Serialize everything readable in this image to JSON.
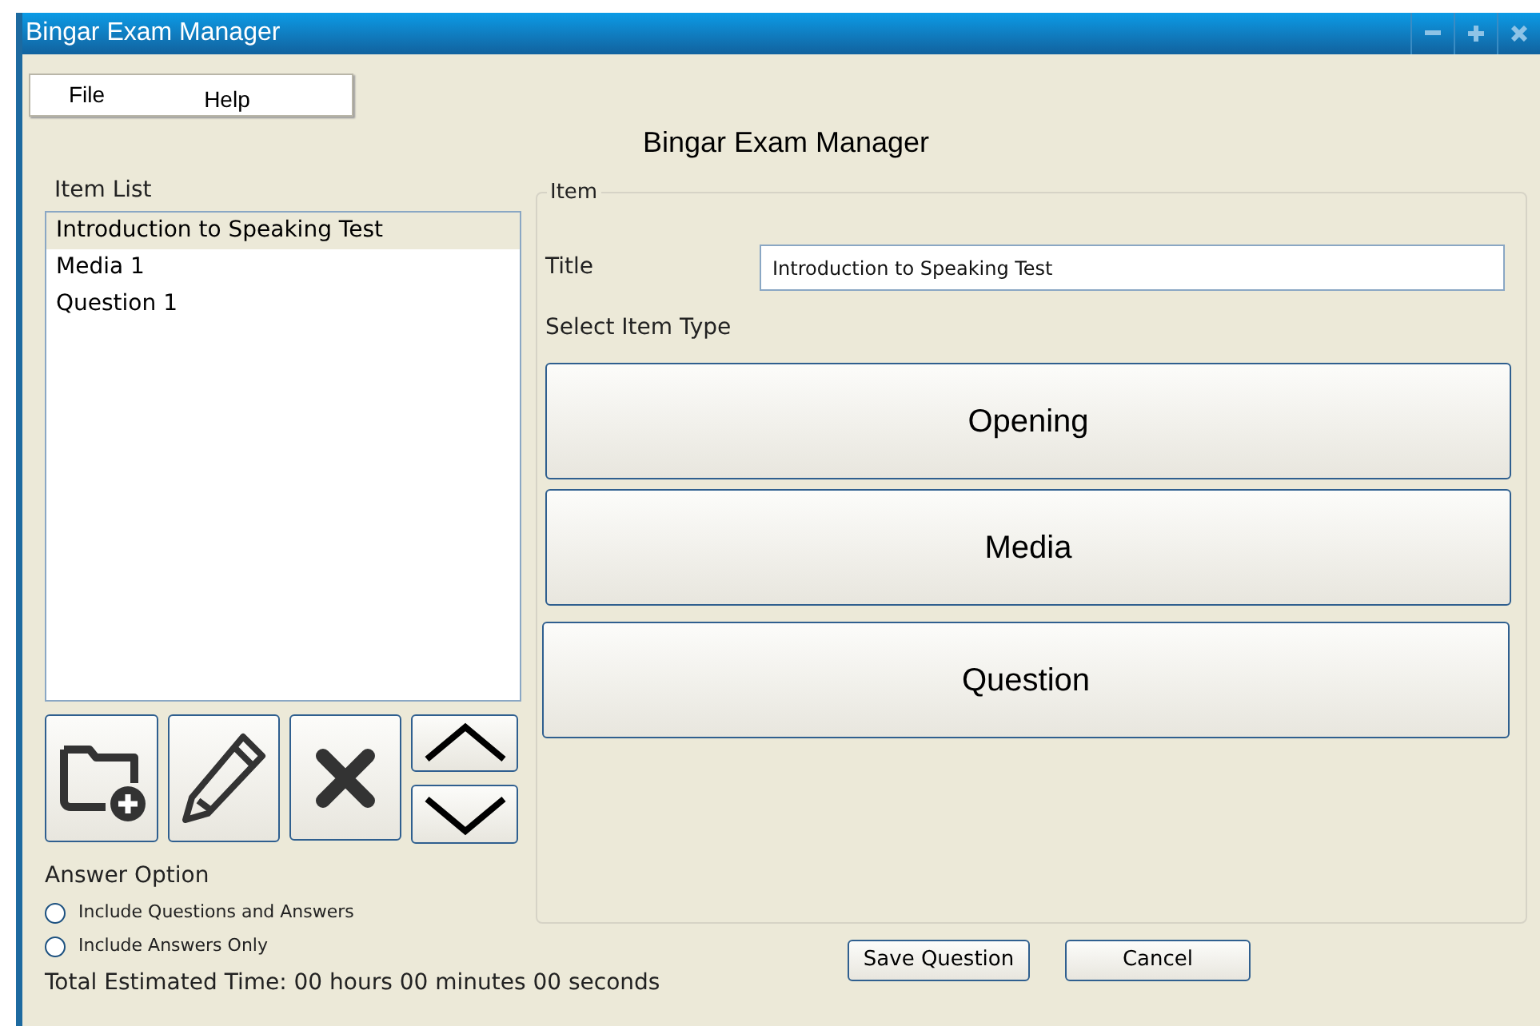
{
  "window": {
    "title": "Bingar Exam Manager"
  },
  "menu": [
    {
      "label": "File"
    },
    {
      "label": "Help"
    }
  ],
  "heading": "Bingar Exam Manager",
  "item_list": {
    "label": "Item List",
    "items": [
      {
        "label": "Introduction to Speaking Test",
        "selected": true
      },
      {
        "label": "Media 1",
        "selected": false
      },
      {
        "label": "Question 1",
        "selected": false
      }
    ]
  },
  "answer_option": {
    "label": "Answer Option",
    "options": [
      {
        "label": "Include Questions and Answers",
        "selected": false
      },
      {
        "label": "Include Answers Only",
        "selected": false
      }
    ]
  },
  "total_time": "Total Estimated Time: 00 hours 00 minutes 00 seconds",
  "item_panel": {
    "legend": "Item",
    "title_label": "Title",
    "title_value": "Introduction to Speaking Test",
    "select_label": "Select Item Type",
    "types": [
      {
        "label": "Opening"
      },
      {
        "label": "Media"
      },
      {
        "label": "Question"
      }
    ]
  },
  "buttons": [
    {
      "label": "Save Question"
    },
    {
      "label": "Cancel"
    }
  ]
}
